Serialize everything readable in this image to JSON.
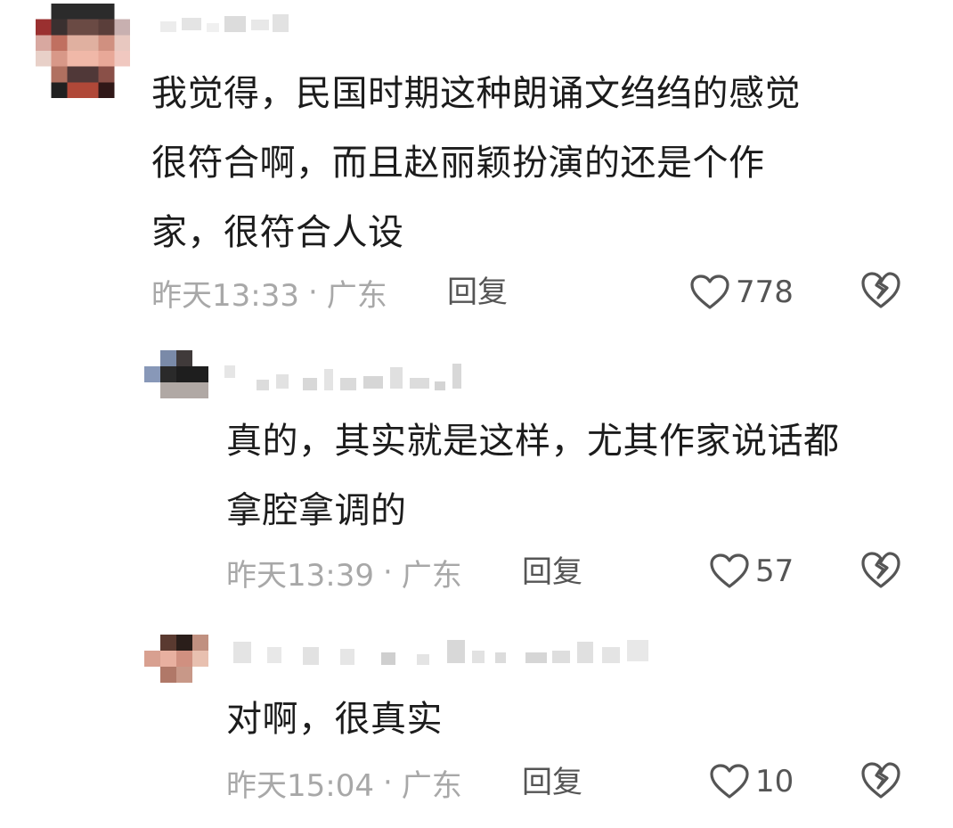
{
  "comments": [
    {
      "text_lines": [
        "我觉得，民国时期这种朗诵文绉绉的感觉",
        "很符合啊，而且赵丽颖扮演的还是个作",
        "家，很符合人设"
      ],
      "time": "昨天13:33",
      "dot": "·",
      "region": "广东",
      "reply_label": "回复",
      "likes": "778"
    },
    {
      "text_lines": [
        "真的，其实就是这样，尤其作家说话都",
        "拿腔拿调的"
      ],
      "time": "昨天13:39",
      "dot": "·",
      "region": "广东",
      "reply_label": "回复",
      "likes": "57"
    },
    {
      "text_lines": [
        "对啊，很真实"
      ],
      "time": "昨天15:04",
      "dot": "·",
      "region": "广东",
      "reply_label": "回复",
      "likes": "10"
    }
  ],
  "colors": {
    "text": "#1c1c1c",
    "meta": "#a8a8a8",
    "action": "#555555"
  },
  "icons": {
    "like": "heart-outline-icon",
    "dislike": "broken-heart-icon"
  }
}
